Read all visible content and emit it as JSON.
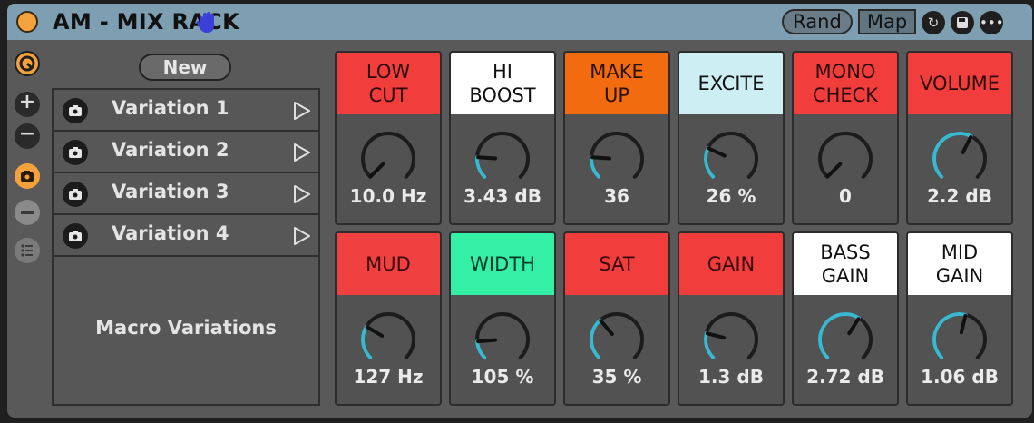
{
  "device": {
    "title": "AM - MIX RACK",
    "buttons": {
      "rand": "Rand",
      "map": "Map"
    },
    "icons": [
      "power-icon",
      "hand-icon",
      "refresh-icon",
      "save-icon",
      "more-icon"
    ]
  },
  "sidebar": {
    "icons": [
      "select-icon",
      "add-icon",
      "remove-icon",
      "camera-icon",
      "minus-icon",
      "list-icon"
    ]
  },
  "variations": {
    "new_label": "New",
    "items": [
      {
        "label": "Variation 1"
      },
      {
        "label": "Variation 2"
      },
      {
        "label": "Variation 3"
      },
      {
        "label": "Variation 4"
      }
    ],
    "panel_label": "Macro Variations"
  },
  "macros": [
    {
      "name_lines": [
        "LOW",
        "CUT"
      ],
      "value": "10.0 Hz",
      "color": "#f23d3d",
      "text_color": "#2a0a0a",
      "level": 0.0
    },
    {
      "name_lines": [
        "HI",
        "BOOST"
      ],
      "value": "3.43 dB",
      "color": "#ffffff",
      "text_color": "#111111",
      "level": 0.18
    },
    {
      "name_lines": [
        "MAKE",
        "UP"
      ],
      "value": "36",
      "color": "#f36b0f",
      "text_color": "#2a1205",
      "level": 0.18
    },
    {
      "name_lines": [
        "EXCITE"
      ],
      "value": "26 %",
      "color": "#cdeff3",
      "text_color": "#111111",
      "level": 0.26
    },
    {
      "name_lines": [
        "MONO",
        "CHECK"
      ],
      "value": "0",
      "color": "#f23d3d",
      "text_color": "#2a0a0a",
      "level": 0.0
    },
    {
      "name_lines": [
        "VOLUME"
      ],
      "value": "2.2 dB",
      "color": "#f23d3d",
      "text_color": "#2a0a0a",
      "level": 0.6
    },
    {
      "name_lines": [
        "MUD"
      ],
      "value": "127 Hz",
      "color": "#f04040",
      "text_color": "#3a0a0a",
      "level": 0.28
    },
    {
      "name_lines": [
        "WIDTH"
      ],
      "value": "105 %",
      "color": "#33f0a6",
      "text_color": "#0c3a28",
      "level": 0.15
    },
    {
      "name_lines": [
        "SAT"
      ],
      "value": "35 %",
      "color": "#f23d3d",
      "text_color": "#3a0a0a",
      "level": 0.35
    },
    {
      "name_lines": [
        "GAIN"
      ],
      "value": "1.3 dB",
      "color": "#f23d3d",
      "text_color": "#3a0a0a",
      "level": 0.22
    },
    {
      "name_lines": [
        "BASS",
        "GAIN"
      ],
      "value": "2.72 dB",
      "color": "#ffffff",
      "text_color": "#111111",
      "level": 0.62
    },
    {
      "name_lines": [
        "MID",
        "GAIN"
      ],
      "value": "1.06 dB",
      "color": "#ffffff",
      "text_color": "#111111",
      "level": 0.55
    }
  ],
  "colors": {
    "title_bar": "#7e9fb1",
    "rack_body": "#595959",
    "accent_orange": "#f3a23d",
    "knob_arc": "#3ab8d0"
  }
}
